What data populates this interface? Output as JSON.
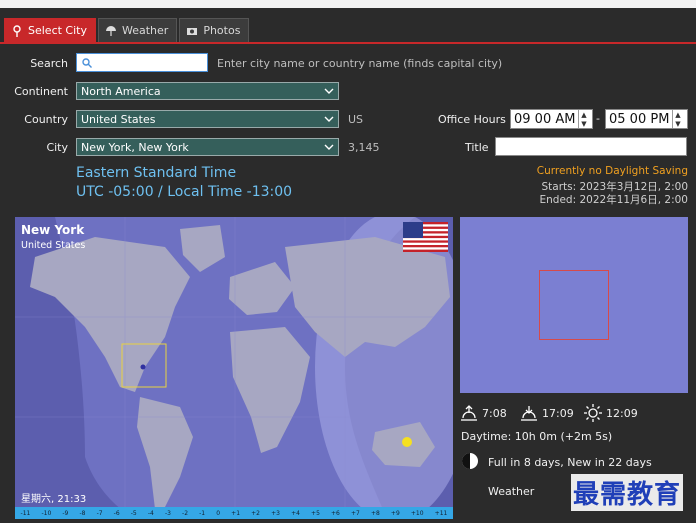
{
  "tabs": [
    {
      "label": "Select City",
      "icon": "pin-icon",
      "active": true
    },
    {
      "label": "Weather",
      "icon": "umbrella-icon",
      "active": false
    },
    {
      "label": "Photos",
      "icon": "camera-icon",
      "active": false
    }
  ],
  "form": {
    "search_label": "Search",
    "search_value": "",
    "search_hint": "Enter city name or country name (finds capital city)",
    "continent_label": "Continent",
    "continent_value": "North America",
    "country_label": "Country",
    "country_value": "United States",
    "country_code": "US",
    "city_label": "City",
    "city_value": "New York, New York",
    "city_count": "3,145"
  },
  "timezone": {
    "name": "Eastern Standard Time",
    "offset": "UTC -05:00 / Local Time -13:00"
  },
  "office": {
    "label": "Office Hours",
    "start": "09 00 AM",
    "end": "05 00 PM",
    "dash": "-",
    "title_label": "Title"
  },
  "dst": {
    "status": "Currently no Daylight Saving",
    "starts": "Starts: 2023年3月12日, 2:00",
    "ended": "Ended: 2022年11月6日, 2:00"
  },
  "map": {
    "city": "New York",
    "country": "United States",
    "local_time": "星期六, 21:33",
    "ruler": [
      "-11",
      "-10",
      "-9",
      "-8",
      "-7",
      "-6",
      "-5",
      "-4",
      "-3",
      "-2",
      "-1",
      "0",
      "+1",
      "+2",
      "+3",
      "+4",
      "+5",
      "+6",
      "+7",
      "+8",
      "+9",
      "+10",
      "+11"
    ]
  },
  "sun": {
    "sunrise": "7:08",
    "sunset": "17:09",
    "noon": "12:09",
    "daytime": "Daytime: 10h 0m (+2m 5s)",
    "moon": "Full in 8 days, New in 22 days",
    "weather": "Weather"
  },
  "watermark": "最需教育",
  "colors": {
    "accent": "#c8282a",
    "field_bg": "#355f5b",
    "tz_text": "#6ec0f0",
    "dst_warn": "#f0a020"
  }
}
